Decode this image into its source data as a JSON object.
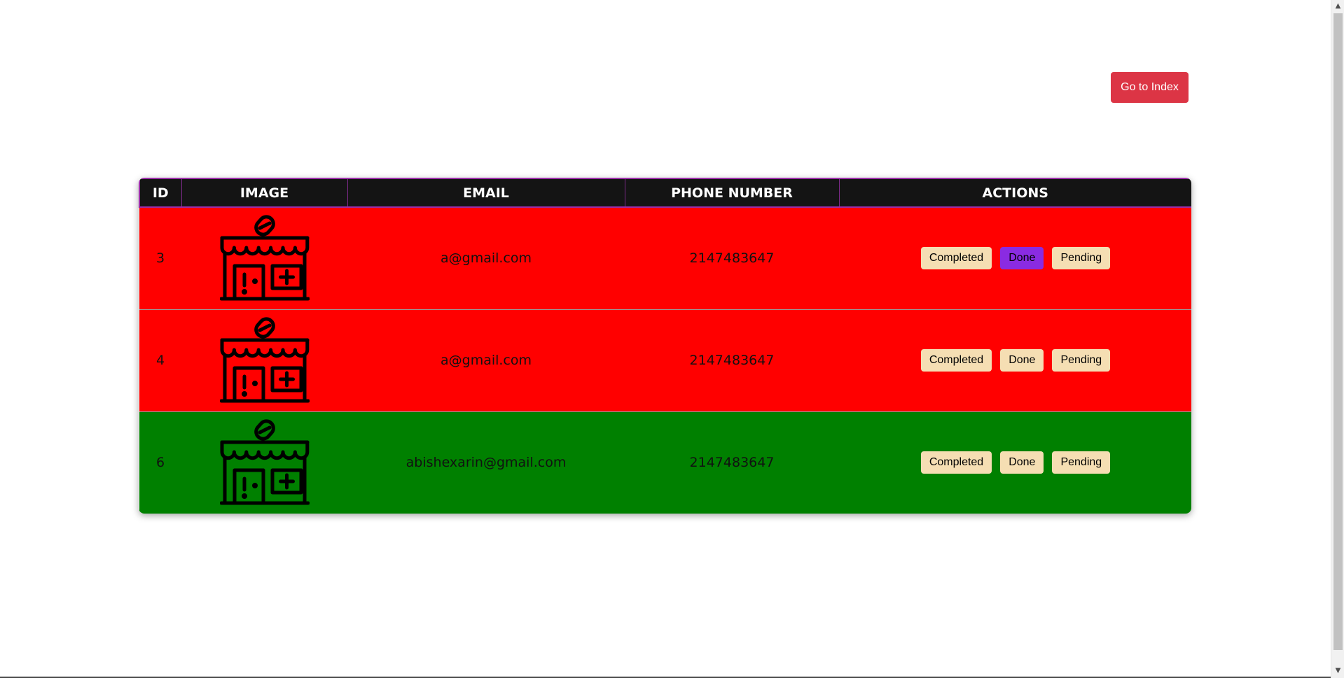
{
  "nav": {
    "index_button": "Go to Index"
  },
  "table": {
    "headers": [
      "ID",
      "IMAGE",
      "EMAIL",
      "PHONE NUMBER",
      "ACTIONS"
    ],
    "rows": [
      {
        "id": "3",
        "email": "a@gmail.com",
        "phone": "2147483647",
        "status_color": "#ff0000",
        "active_action": "Done"
      },
      {
        "id": "4",
        "email": "a@gmail.com",
        "phone": "2147483647",
        "status_color": "#ff0000",
        "active_action": ""
      },
      {
        "id": "6",
        "email": "abishexarin@gmail.com",
        "phone": "2147483647",
        "status_color": "#008000",
        "active_action": ""
      }
    ],
    "image_icon": "pharmacy-store-icon",
    "actions": [
      "Completed",
      "Done",
      "Pending"
    ]
  },
  "colors": {
    "header_bg": "#141414",
    "header_border": "#9b2ea8",
    "pending_row": "#ff0000",
    "completed_row": "#008000",
    "action_button": "#f5deb3",
    "action_active": "#8a2be2",
    "index_button": "#dc3545"
  }
}
